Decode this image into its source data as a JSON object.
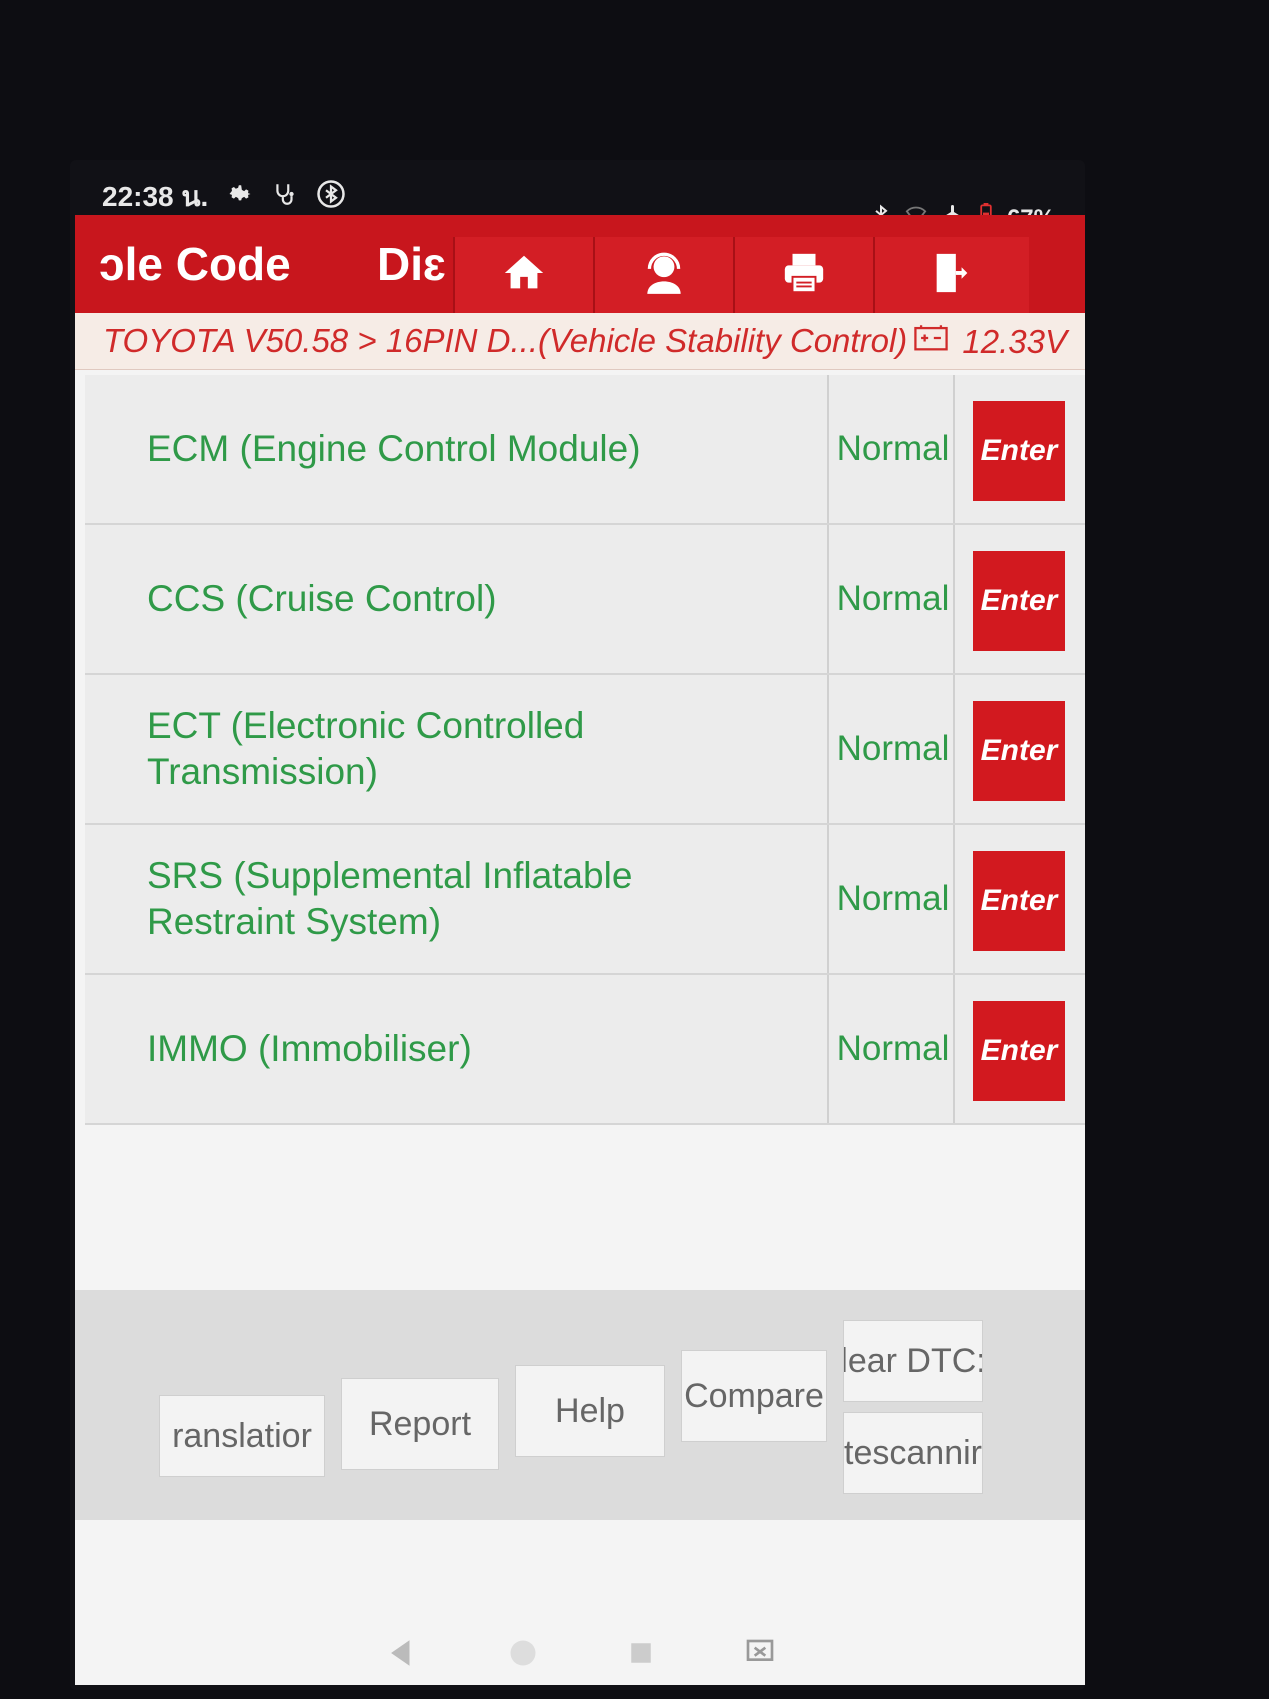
{
  "status_bar": {
    "time": "22:38 น.",
    "battery": "67%"
  },
  "top_bar": {
    "title_left": "ɔle Code",
    "title_mid": "Diɛ",
    "buttons": [
      "home-icon",
      "support-agent-icon",
      "printer-icon",
      "exit-icon"
    ]
  },
  "breadcrumb": {
    "path": "TOYOTA V50.58 > 16PIN D...(Vehicle Stability Control)",
    "voltage": "12.33V"
  },
  "systems": [
    {
      "name": "ECM (Engine Control Module)",
      "status": "Normal",
      "action": "Enter"
    },
    {
      "name": "CCS (Cruise Control)",
      "status": "Normal",
      "action": "Enter"
    },
    {
      "name": "ECT (Electronic Controlled Transmission)",
      "status": "Normal",
      "action": "Enter"
    },
    {
      "name": "SRS (Supplemental Inflatable Restraint System)",
      "status": "Normal",
      "action": "Enter"
    },
    {
      "name": "IMMO (Immobiliser)",
      "status": "Normal",
      "action": "Enter"
    }
  ],
  "footer": {
    "translation": "ranslatior",
    "report": "Report",
    "help": "Help",
    "compare": "Compare",
    "clear_dtc": "lear DTC:",
    "rescanning": "tescannir"
  },
  "colors": {
    "brand_red": "#c8161d",
    "status_green": "#2f9a48"
  }
}
